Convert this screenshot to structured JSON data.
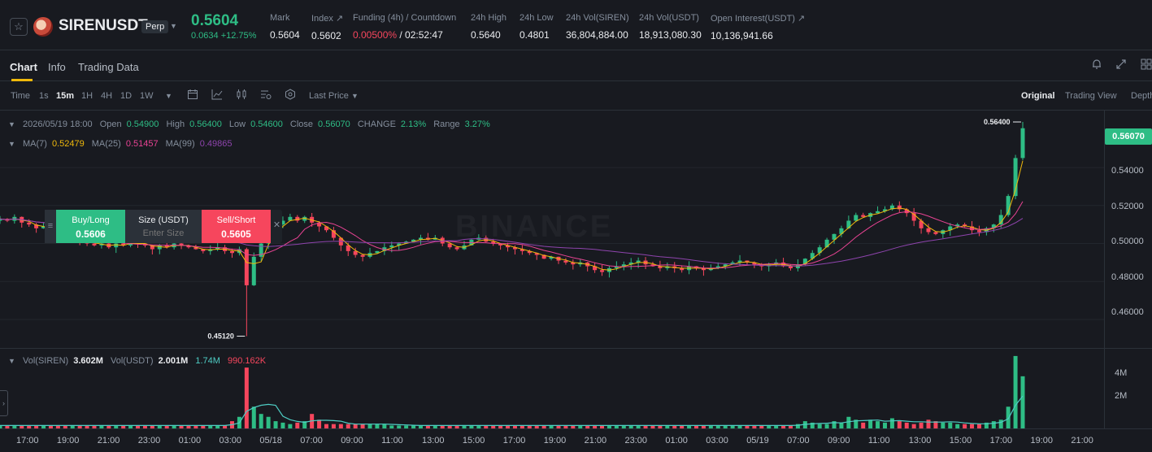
{
  "header": {
    "symbol": "SIRENUSDT",
    "contract_type": "Perp",
    "last_price": "0.5604",
    "change_abs": "0.0634",
    "change_pct": "+12.75%",
    "mark_label": "Mark",
    "mark_value": "0.5604",
    "index_label": "Index",
    "index_value": "0.5602",
    "funding_label": "Funding (4h) / Countdown",
    "funding_rate": "0.00500%",
    "countdown": "/ 02:52:47",
    "high_label": "24h High",
    "high_value": "0.5640",
    "low_label": "24h Low",
    "low_value": "0.4801",
    "vol_base_label": "24h Vol(SIREN)",
    "vol_base_value": "36,804,884.00",
    "vol_quote_label": "24h Vol(USDT)",
    "vol_quote_value": "18,913,080.30",
    "oi_label": "Open Interest(USDT)",
    "oi_value": "10,136,941.66"
  },
  "tabs": [
    {
      "label": "Chart",
      "active": true
    },
    {
      "label": "Info",
      "active": false
    },
    {
      "label": "Trading Data",
      "active": false
    }
  ],
  "toolbar": {
    "time_label": "Time",
    "intervals": [
      "1s",
      "15m",
      "1H",
      "4H",
      "1D",
      "1W"
    ],
    "active_interval": "15m",
    "price_source": "Last Price",
    "views": [
      "Original",
      "Trading View",
      "Depth"
    ],
    "active_view": "Original"
  },
  "ohlc": {
    "datetime": "2026/05/19 18:00",
    "open_label": "Open",
    "open": "0.54900",
    "high_label": "High",
    "high": "0.56400",
    "low_label": "Low",
    "low": "0.54600",
    "close_label": "Close",
    "close": "0.56070",
    "change_label": "CHANGE",
    "change": "2.13%",
    "range_label": "Range",
    "range": "3.27%"
  },
  "ma": {
    "ma7_label": "MA(7)",
    "ma7": "0.52479",
    "ma25_label": "MA(25)",
    "ma25": "0.51457",
    "ma99_label": "MA(99)",
    "ma99": "0.49865",
    "colors": {
      "ma7": "#f0b90b",
      "ma25": "#e84393",
      "ma99": "#8e44ad"
    }
  },
  "order_panel": {
    "buy_label": "Buy/Long",
    "buy_price": "0.5606",
    "size_label": "Size (USDT)",
    "size_placeholder": "Enter Size",
    "sell_label": "Sell/Short",
    "sell_price": "0.5605"
  },
  "watermark": "BINANCE",
  "price_axis": {
    "ticks": [
      "0.54000",
      "0.52000",
      "0.50000",
      "0.48000",
      "0.46000"
    ],
    "last_tag": "0.56070",
    "high_marker": "0.56400",
    "low_marker": "0.45120"
  },
  "volume": {
    "base_label": "Vol(SIREN)",
    "base_value": "3.602M",
    "quote_label": "Vol(USDT)",
    "quote_value": "2.001M",
    "ma1": "1.74M",
    "ma2": "990.162K",
    "ticks": [
      "4M",
      "2M"
    ]
  },
  "time_axis": [
    "17:00",
    "19:00",
    "21:00",
    "23:00",
    "01:00",
    "03:00",
    "05/18",
    "07:00",
    "09:00",
    "11:00",
    "13:00",
    "15:00",
    "17:00",
    "19:00",
    "21:00",
    "23:00",
    "01:00",
    "03:00",
    "05/19",
    "07:00",
    "09:00",
    "11:00",
    "13:00",
    "15:00",
    "17:00",
    "19:00",
    "21:00"
  ],
  "colors": {
    "up": "#2ebd85",
    "down": "#f6465d",
    "accent": "#f0b90b"
  },
  "icons": [
    "star-icon",
    "bell-icon",
    "expand-icon",
    "grid-icon",
    "calendar-icon",
    "indicator-icon",
    "candle-type-icon",
    "settings-icon",
    "hexagon-icon"
  ],
  "chart_data": {
    "type": "candlestick",
    "xlabel": "",
    "ylabel": "",
    "ylim": [
      0.445,
      0.57
    ],
    "x_ticks": [
      "17:00",
      "19:00",
      "21:00",
      "23:00",
      "01:00",
      "03:00",
      "05/18",
      "07:00",
      "09:00",
      "11:00",
      "13:00",
      "15:00",
      "17:00",
      "19:00",
      "21:00",
      "23:00",
      "01:00",
      "03:00",
      "05/19",
      "07:00",
      "09:00",
      "11:00",
      "13:00",
      "15:00",
      "17:00",
      "19:00",
      "21:00"
    ],
    "y_ticks": [
      0.46,
      0.48,
      0.5,
      0.52,
      0.54
    ],
    "close_profile": [
      0.513,
      0.512,
      0.514,
      0.511,
      0.51,
      0.508,
      0.509,
      0.507,
      0.505,
      0.503,
      0.504,
      0.502,
      0.5,
      0.499,
      0.5,
      0.498,
      0.5,
      0.499,
      0.501,
      0.5,
      0.499,
      0.497,
      0.499,
      0.498,
      0.5,
      0.499,
      0.498,
      0.497,
      0.496,
      0.497,
      0.498,
      0.496,
      0.495,
      0.497,
      0.478,
      0.493,
      0.5,
      0.505,
      0.51,
      0.512,
      0.514,
      0.512,
      0.514,
      0.511,
      0.509,
      0.507,
      0.503,
      0.499,
      0.496,
      0.494,
      0.493,
      0.495,
      0.496,
      0.498,
      0.499,
      0.5,
      0.501,
      0.502,
      0.503,
      0.502,
      0.503,
      0.5,
      0.498,
      0.497,
      0.499,
      0.502,
      0.503,
      0.501,
      0.5,
      0.499,
      0.498,
      0.497,
      0.496,
      0.495,
      0.494,
      0.492,
      0.493,
      0.491,
      0.49,
      0.489,
      0.49,
      0.488,
      0.486,
      0.485,
      0.487,
      0.488,
      0.489,
      0.49,
      0.491,
      0.489,
      0.488,
      0.487,
      0.488,
      0.487,
      0.486,
      0.488,
      0.487,
      0.486,
      0.487,
      0.488,
      0.489,
      0.49,
      0.491,
      0.49,
      0.489,
      0.488,
      0.489,
      0.49,
      0.488,
      0.487,
      0.489,
      0.492,
      0.495,
      0.498,
      0.502,
      0.505,
      0.508,
      0.512,
      0.515,
      0.514,
      0.516,
      0.517,
      0.518,
      0.52,
      0.518,
      0.516,
      0.512,
      0.508,
      0.506,
      0.505,
      0.507,
      0.509,
      0.51,
      0.509,
      0.507,
      0.506,
      0.508,
      0.51,
      0.515,
      0.525,
      0.545,
      0.5607
    ],
    "low": 0.4512,
    "high": 0.564,
    "volume_profile_m": [
      0.2,
      0.2,
      0.2,
      0.2,
      0.2,
      0.2,
      0.2,
      0.2,
      0.2,
      0.2,
      0.2,
      0.2,
      0.2,
      0.2,
      0.2,
      0.2,
      0.2,
      0.2,
      0.2,
      0.2,
      0.2,
      0.2,
      0.2,
      0.2,
      0.2,
      0.2,
      0.2,
      0.2,
      0.2,
      0.2,
      0.2,
      0.2,
      0.5,
      0.8,
      4.2,
      1.5,
      1.0,
      0.8,
      0.5,
      0.4,
      0.3,
      0.4,
      0.5,
      1.0,
      0.6,
      0.3,
      0.3,
      0.3,
      0.3,
      0.3,
      0.3,
      0.3,
      0.3,
      0.3,
      0.2,
      0.2,
      0.2,
      0.2,
      0.2,
      0.2,
      0.2,
      0.2,
      0.2,
      0.2,
      0.2,
      0.2,
      0.2,
      0.2,
      0.2,
      0.2,
      0.2,
      0.2,
      0.2,
      0.2,
      0.2,
      0.2,
      0.2,
      0.2,
      0.2,
      0.2,
      0.2,
      0.2,
      0.2,
      0.2,
      0.2,
      0.2,
      0.2,
      0.2,
      0.2,
      0.2,
      0.2,
      0.2,
      0.2,
      0.2,
      0.2,
      0.2,
      0.2,
      0.2,
      0.2,
      0.2,
      0.2,
      0.2,
      0.2,
      0.2,
      0.2,
      0.2,
      0.2,
      0.2,
      0.2,
      0.2,
      0.3,
      0.5,
      0.4,
      0.3,
      0.3,
      0.5,
      0.4,
      0.8,
      0.6,
      0.4,
      0.6,
      0.5,
      0.4,
      0.7,
      0.5,
      0.4,
      0.3,
      0.4,
      0.6,
      0.5,
      0.4,
      0.4,
      0.3,
      0.3,
      0.3,
      0.3,
      0.4,
      0.5,
      0.6,
      1.5,
      5.0,
      3.6
    ]
  }
}
